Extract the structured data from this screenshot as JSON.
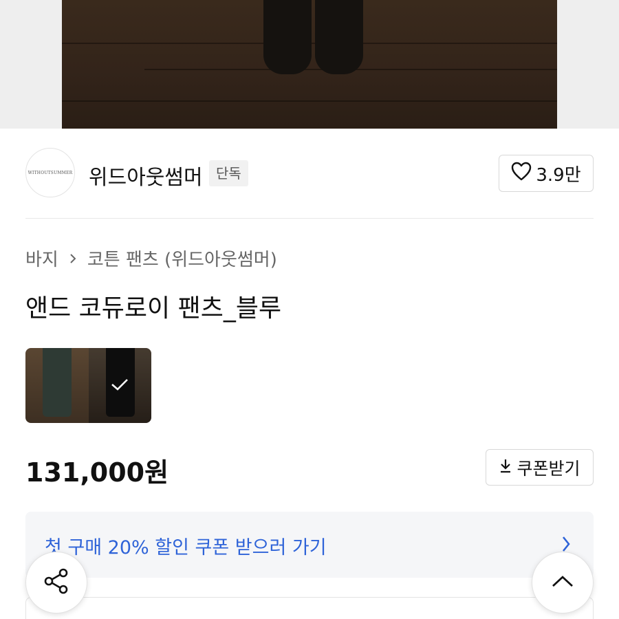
{
  "brand": {
    "logo_text": "WITHOUTSUMMER",
    "name": "위드아웃썸머",
    "badge": "단독",
    "like_count": "3.9만"
  },
  "breadcrumb": {
    "category": "바지",
    "subcategory": "코튼 팬츠 (위드아웃썸머)"
  },
  "product": {
    "title": "앤드 코듀로이 팬츠_블루",
    "price": "131,000원"
  },
  "actions": {
    "coupon_label": "쿠폰받기"
  },
  "banner": {
    "text": "첫 구매 20% 할인 쿠폰 받으러 가기"
  },
  "colors": {
    "link_blue": "#2e63d8",
    "text_primary": "#111111",
    "text_secondary": "#666666"
  },
  "icons": {
    "like": "heart-icon",
    "separator": "chevron-right-icon",
    "selected": "check-icon",
    "download": "download-icon",
    "banner_arrow": "chevron-right-icon",
    "share": "share-icon",
    "scroll_top": "chevron-up-icon"
  }
}
